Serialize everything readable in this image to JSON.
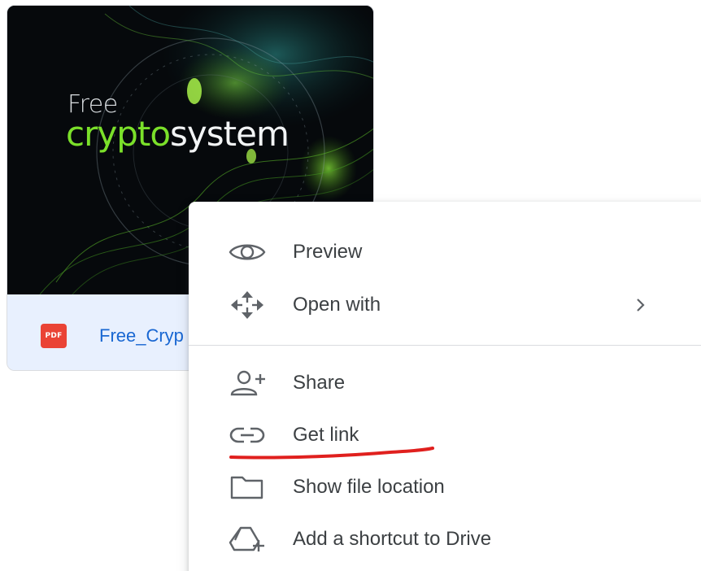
{
  "file": {
    "thumbnail_text": {
      "line1": "Free",
      "crypto": "crypto",
      "system": "system"
    },
    "type_badge": "PDF",
    "name": "Free_Cryp"
  },
  "context_menu": {
    "items": [
      {
        "label": "Preview",
        "icon": "eye-icon"
      },
      {
        "label": "Open with",
        "icon": "move-arrows-icon",
        "submenu_indicator": "chevron-right-icon"
      },
      {
        "label": "Share",
        "icon": "person-add-icon"
      },
      {
        "label": "Get link",
        "icon": "link-icon"
      },
      {
        "label": "Show file location",
        "icon": "folder-icon"
      },
      {
        "label": "Add a shortcut to Drive",
        "icon": "drive-shortcut-icon"
      }
    ]
  },
  "annotation": {
    "underline_color": "#e0201e",
    "underlined_item": "Get link"
  },
  "colors": {
    "card_background": "#e8f0fe",
    "file_name": "#1967d2",
    "pdf_badge": "#ea4335",
    "menu_text": "#3c4043",
    "icon_gray": "#5f6368",
    "thumbnail_green": "#7be02a"
  }
}
